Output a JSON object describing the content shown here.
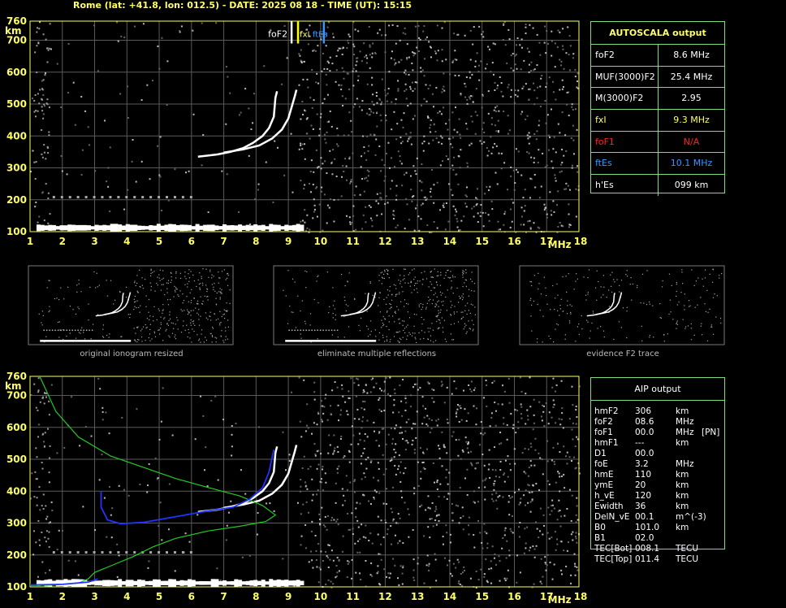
{
  "header": "Rome (lat: +41.8, lon: 012.5) - DATE: 2025 08 18 - TIME (UT): 15:15",
  "chart_data": [
    {
      "type": "scatter",
      "name": "ionogram-main",
      "x_axis": {
        "range": [
          1,
          18
        ],
        "ticks": [
          "1",
          "2",
          "3",
          "4",
          "5",
          "6",
          "7",
          "8",
          "9",
          "10",
          "11",
          "12",
          "13",
          "14",
          "15",
          "16",
          "17",
          "18"
        ],
        "unit": "MHz"
      },
      "y_axis": {
        "range": [
          100,
          760
        ],
        "ticks": [
          "100",
          "200",
          "300",
          "400",
          "500",
          "600",
          "700",
          "760"
        ],
        "unit": "km"
      },
      "grid": true,
      "markers": [
        {
          "label": "foF2",
          "x": 9.1,
          "color": "#ffffff"
        },
        {
          "label": "fxI",
          "x": 9.3,
          "color": "#ffff00"
        },
        {
          "label": "ftEs",
          "x": 10.1,
          "color": "#3399ff"
        }
      ],
      "traces": {
        "o_trace": [
          [
            6.2,
            335
          ],
          [
            6.8,
            342
          ],
          [
            7.2,
            350
          ],
          [
            7.6,
            362
          ],
          [
            7.9,
            378
          ],
          [
            8.2,
            400
          ],
          [
            8.4,
            425
          ],
          [
            8.55,
            460
          ],
          [
            8.6,
            520
          ],
          [
            8.65,
            540
          ]
        ],
        "x_trace": [
          [
            7.0,
            348
          ],
          [
            7.6,
            358
          ],
          [
            8.1,
            370
          ],
          [
            8.5,
            392
          ],
          [
            8.8,
            420
          ],
          [
            9.0,
            455
          ],
          [
            9.1,
            490
          ],
          [
            9.2,
            525
          ],
          [
            9.25,
            545
          ]
        ],
        "es_trace": [
          [
            1.5,
            110
          ],
          [
            4,
            112
          ],
          [
            6,
            113
          ],
          [
            8,
            112
          ],
          [
            9.5,
            111
          ]
        ],
        "multiple_es": [
          [
            1.6,
            210
          ],
          [
            3,
            212
          ],
          [
            5,
            211
          ],
          [
            6,
            210
          ]
        ]
      }
    },
    {
      "type": "scatter",
      "name": "ionogram-aip",
      "x_axis": {
        "range": [
          1,
          18
        ],
        "ticks": [
          "1",
          "2",
          "3",
          "4",
          "5",
          "6",
          "7",
          "8",
          "9",
          "10",
          "11",
          "12",
          "13",
          "14",
          "15",
          "16",
          "17",
          "18"
        ],
        "unit": "MHz"
      },
      "y_axis": {
        "range": [
          100,
          760
        ],
        "ticks": [
          "100",
          "200",
          "300",
          "400",
          "500",
          "600",
          "700",
          "760"
        ],
        "unit": "km"
      },
      "grid": true,
      "profile_green": [
        [
          1.3,
          760
        ],
        [
          1.8,
          650
        ],
        [
          2.5,
          570
        ],
        [
          3.5,
          510
        ],
        [
          4.5,
          475
        ],
        [
          5.5,
          440
        ],
        [
          6.5,
          412
        ],
        [
          7.5,
          385
        ],
        [
          8.2,
          355
        ],
        [
          8.6,
          325
        ],
        [
          8.3,
          305
        ],
        [
          7.5,
          290
        ],
        [
          6.5,
          275
        ],
        [
          5.5,
          252
        ],
        [
          4.8,
          225
        ],
        [
          4.2,
          195
        ],
        [
          3.6,
          170
        ],
        [
          3.0,
          145
        ],
        [
          2.8,
          125
        ],
        [
          2.5,
          112
        ],
        [
          1.8,
          106
        ],
        [
          1.0,
          104
        ]
      ],
      "profile_blue": [
        [
          3.2,
          400
        ],
        [
          3.2,
          350
        ],
        [
          3.4,
          310
        ],
        [
          3.8,
          298
        ],
        [
          4.5,
          302
        ],
        [
          5.5,
          320
        ],
        [
          6.5,
          338
        ],
        [
          7.3,
          350
        ],
        [
          7.8,
          375
        ],
        [
          8.2,
          410
        ],
        [
          8.4,
          460
        ],
        [
          8.55,
          530
        ]
      ],
      "blue_low": [
        [
          1.0,
          106
        ],
        [
          2.0,
          108
        ],
        [
          2.8,
          115
        ],
        [
          3.1,
          125
        ]
      ]
    }
  ],
  "autoscala": {
    "title": "AUTOSCALA output",
    "rows": [
      {
        "label": "foF2",
        "value": "8.6 MHz",
        "color": "#ffffff"
      },
      {
        "label": "MUF(3000)F2",
        "value": "25.4 MHz",
        "color": "#ffffff"
      },
      {
        "label": "M(3000)F2",
        "value": "2.95",
        "color": "#ffffff"
      },
      {
        "label": "fxI",
        "value": "9.3 MHz",
        "color": "#ffff66"
      },
      {
        "label": "foF1",
        "value": "N/A",
        "color": "#ff2222"
      },
      {
        "label": "ftEs",
        "value": "10.1 MHz",
        "color": "#3399ff"
      },
      {
        "label": "h'Es",
        "value": "099    km",
        "color": "#ffffff"
      }
    ]
  },
  "aip": {
    "title": "AIP output",
    "rows": [
      [
        "hmF2",
        "306",
        "km",
        ""
      ],
      [
        "foF2",
        "08.6",
        "MHz",
        ""
      ],
      [
        "foF1",
        "00.0",
        "MHz",
        "[PN]"
      ],
      [
        "hmF1",
        "---",
        "km",
        ""
      ],
      [
        "D1",
        "00.0",
        "",
        ""
      ],
      [
        "foE",
        "3.2",
        "MHz",
        ""
      ],
      [
        "hmE",
        "110",
        "km",
        ""
      ],
      [
        "ymE",
        "20",
        "km",
        ""
      ],
      [
        "h_vE",
        "120",
        "km",
        ""
      ],
      [
        "Ewidth",
        "36",
        "km",
        ""
      ],
      [
        "DelN_vE",
        "00.1",
        "m^(-3)",
        ""
      ],
      [
        "B0",
        "101.0",
        "km",
        ""
      ],
      [
        "B1",
        "02.0",
        "",
        ""
      ],
      [
        "TEC[Bot]",
        "008.1",
        "TECU",
        ""
      ],
      [
        "TEC[Top]",
        "011.4",
        "TECU",
        ""
      ]
    ]
  },
  "thumbnails": [
    {
      "caption": "original ionogram resized"
    },
    {
      "caption": "eliminate multiple reflections"
    },
    {
      "caption": "evidence F2 trace"
    }
  ],
  "axis_unit_x": "MHz",
  "axis_unit_y": "km",
  "colors": {
    "axis": "#ffff66",
    "grid": "#5a5a5a",
    "profile": "#22cc22",
    "profile_fit": "#2233ff"
  }
}
